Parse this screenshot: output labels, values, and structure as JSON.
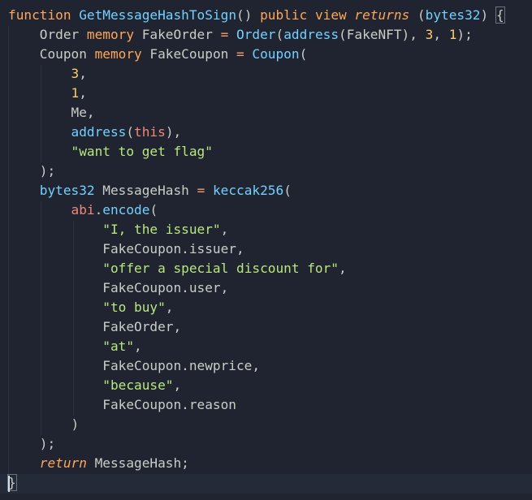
{
  "editor": {
    "lines": [
      [
        {
          "t": "function",
          "c": "kw"
        },
        {
          "t": " "
        },
        {
          "t": "GetMessageHashToSign",
          "c": "fn"
        },
        {
          "t": "() "
        },
        {
          "t": "public",
          "c": "kw"
        },
        {
          "t": " "
        },
        {
          "t": "view",
          "c": "kw"
        },
        {
          "t": " "
        },
        {
          "t": "returns",
          "c": "it"
        },
        {
          "t": " ("
        },
        {
          "t": "bytes32",
          "c": "ty"
        },
        {
          "t": ") "
        },
        {
          "t": "{",
          "c": "bm"
        }
      ],
      [
        {
          "t": "    Order "
        },
        {
          "t": "memory",
          "c": "kw"
        },
        {
          "t": " FakeOrder "
        },
        {
          "t": "=",
          "c": "op"
        },
        {
          "t": " "
        },
        {
          "t": "Order",
          "c": "fn"
        },
        {
          "t": "("
        },
        {
          "t": "address",
          "c": "fn"
        },
        {
          "t": "(FakeNFT), "
        },
        {
          "t": "3",
          "c": "num"
        },
        {
          "t": ", "
        },
        {
          "t": "1",
          "c": "num"
        },
        {
          "t": ");"
        }
      ],
      [
        {
          "t": "    Coupon "
        },
        {
          "t": "memory",
          "c": "kw"
        },
        {
          "t": " FakeCoupon "
        },
        {
          "t": "=",
          "c": "op"
        },
        {
          "t": " "
        },
        {
          "t": "Coupon",
          "c": "fn"
        },
        {
          "t": "("
        }
      ],
      [
        {
          "t": "        "
        },
        {
          "t": "3",
          "c": "num"
        },
        {
          "t": ","
        }
      ],
      [
        {
          "t": "        "
        },
        {
          "t": "1",
          "c": "num"
        },
        {
          "t": ","
        }
      ],
      [
        {
          "t": "        Me,"
        }
      ],
      [
        {
          "t": "        "
        },
        {
          "t": "address",
          "c": "fn"
        },
        {
          "t": "("
        },
        {
          "t": "this",
          "c": "sp"
        },
        {
          "t": "),"
        }
      ],
      [
        {
          "t": "        "
        },
        {
          "t": "\"want to get flag\"",
          "c": "str"
        }
      ],
      [
        {
          "t": "    );"
        }
      ],
      [
        {
          "t": "    "
        },
        {
          "t": "bytes32",
          "c": "ty"
        },
        {
          "t": " MessageHash "
        },
        {
          "t": "=",
          "c": "op"
        },
        {
          "t": " "
        },
        {
          "t": "keccak256",
          "c": "fn"
        },
        {
          "t": "("
        }
      ],
      [
        {
          "t": "        "
        },
        {
          "t": "abi",
          "c": "sp"
        },
        {
          "t": "."
        },
        {
          "t": "encode",
          "c": "fn"
        },
        {
          "t": "("
        }
      ],
      [
        {
          "t": "            "
        },
        {
          "t": "\"I, the issuer\"",
          "c": "str"
        },
        {
          "t": ","
        }
      ],
      [
        {
          "t": "            FakeCoupon.issuer,"
        }
      ],
      [
        {
          "t": "            "
        },
        {
          "t": "\"offer a special discount for\"",
          "c": "str"
        },
        {
          "t": ","
        }
      ],
      [
        {
          "t": "            FakeCoupon.user,"
        }
      ],
      [
        {
          "t": "            "
        },
        {
          "t": "\"to buy\"",
          "c": "str"
        },
        {
          "t": ","
        }
      ],
      [
        {
          "t": "            FakeOrder,"
        }
      ],
      [
        {
          "t": "            "
        },
        {
          "t": "\"at\"",
          "c": "str"
        },
        {
          "t": ","
        }
      ],
      [
        {
          "t": "            FakeCoupon.newprice,"
        }
      ],
      [
        {
          "t": "            "
        },
        {
          "t": "\"because\"",
          "c": "str"
        },
        {
          "t": ","
        }
      ],
      [
        {
          "t": "            FakeCoupon.reason"
        }
      ],
      [
        {
          "t": "        )"
        }
      ],
      [
        {
          "t": "    );"
        }
      ],
      [
        {
          "t": "    "
        },
        {
          "t": "return",
          "c": "it"
        },
        {
          "t": " MessageHash;"
        }
      ],
      [
        {
          "t": "}",
          "c": "bm"
        }
      ]
    ]
  }
}
